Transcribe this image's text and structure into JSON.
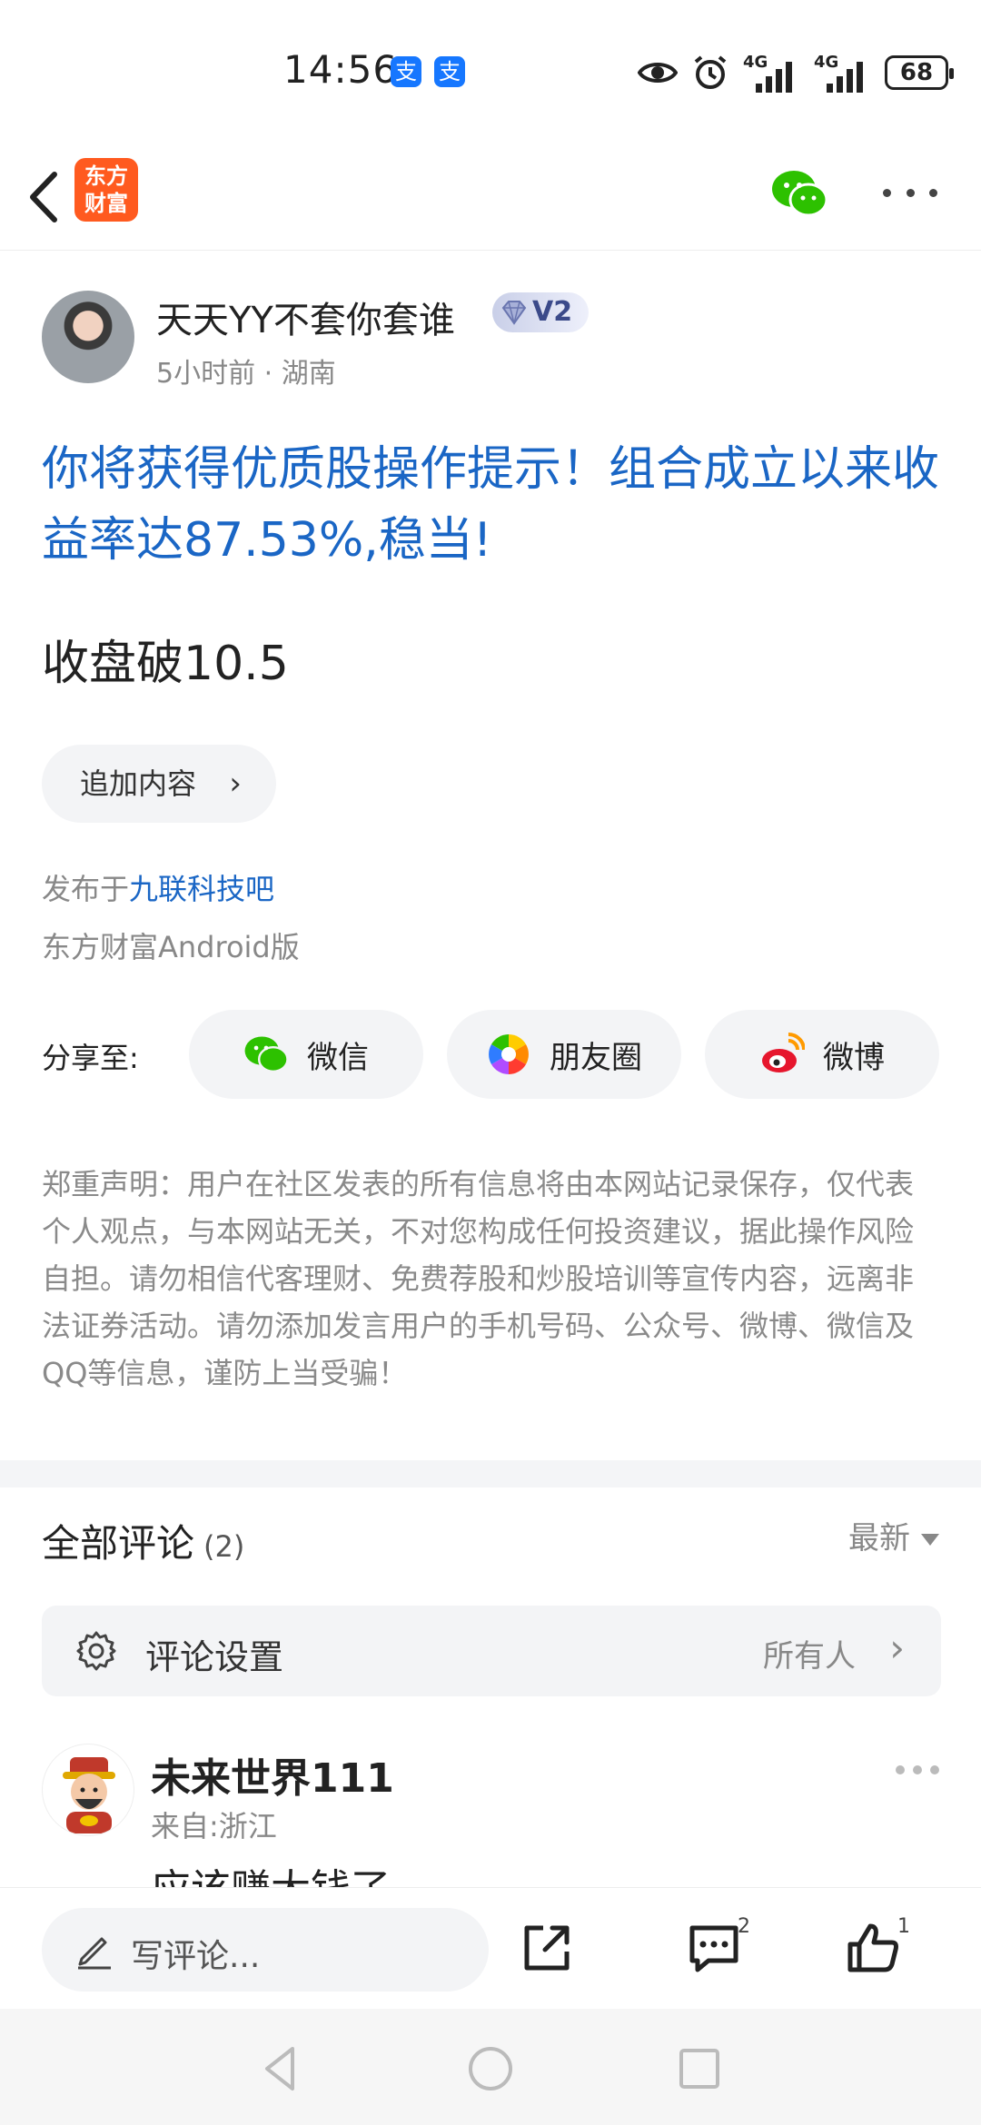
{
  "status_bar": {
    "time": "14:56",
    "pay_icon_1": "支",
    "pay_icon_2": "支",
    "network_1": "4G",
    "network_2": "4G",
    "battery": "68"
  },
  "header": {
    "logo_text_line1": "东方",
    "logo_text_line2": "财富"
  },
  "post": {
    "author_name": "天天YY不套你套谁",
    "level_badge": "V2",
    "meta": "5小时前 · 湖南",
    "title": "你将获得优质股操作提示！组合成立以来收益率达87.53%,稳当!",
    "body": "收盘破10.5",
    "append_label": "追加内容",
    "published_prefix": "发布于",
    "published_forum": "九联科技吧",
    "client": "东方财富Android版"
  },
  "share": {
    "label": "分享至:",
    "wechat": "微信",
    "moments": "朋友圈",
    "weibo": "微博"
  },
  "disclaimer": "郑重声明：用户在社区发表的所有信息将由本网站记录保存，仅代表个人观点，与本网站无关，不对您构成任何投资建议，据此操作风险自担。请勿相信代客理财、免费荐股和炒股培训等宣传内容，远离非法证券活动。请勿添加发言用户的手机号码、公众号、微博、微信及QQ等信息，谨防上当受骗！",
  "comments": {
    "title": "全部评论",
    "count": "(2)",
    "sort_label": "最新",
    "settings_label": "评论设置",
    "settings_value": "所有人",
    "items": [
      {
        "name": "未来世界111",
        "from": "来自:浙江",
        "text": "应该赚大钱了"
      }
    ]
  },
  "bottom_bar": {
    "write_placeholder": "写评论...",
    "comment_badge": "2",
    "like_badge": "1"
  },
  "colors": {
    "link_blue": "#1a66c5",
    "brand_orange": "#ff5a1f",
    "wechat_green": "#2dc100"
  }
}
